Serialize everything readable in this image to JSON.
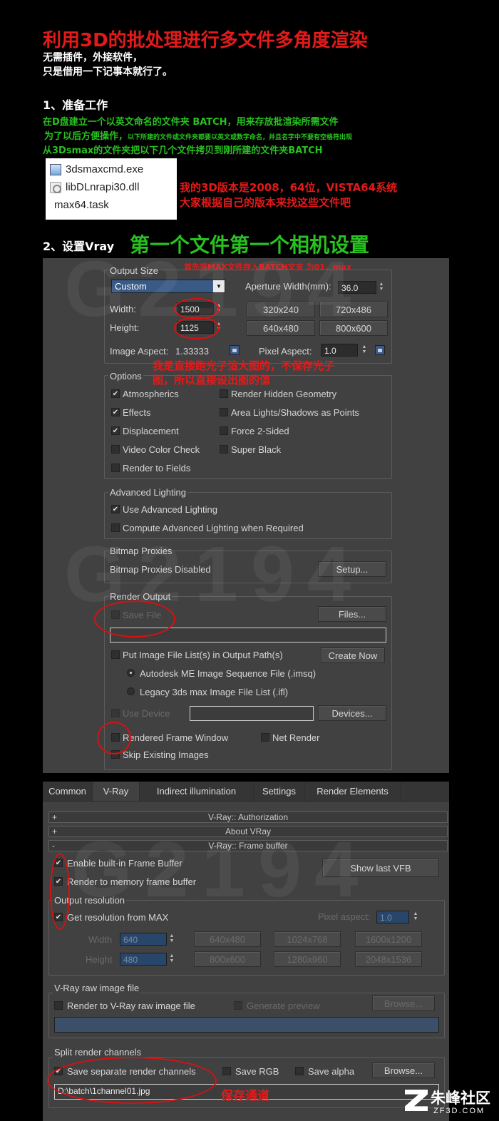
{
  "intro": {
    "title": "利用3D的批处理进行多文件多角度渲染",
    "line1": "无需插件，外接软件，",
    "line2": "只是借用一下记事本就行了。",
    "section1": "1、准备工作",
    "step_a": "在D盘建立一个以英文命名的文件夹 BATCH，用来存放批渲染所需文件",
    "step_b_big": "为了以后方便操作，",
    "step_b_small": "以下所建的文件或文件夹都要以英文或数字命名，并且名字中不要有空格符出现",
    "step_c": "从3Dsmax的文件夹把以下几个文件拷贝到刚所建的文件夹BATCH",
    "files": [
      "3dsmaxcmd.exe",
      "libDLnrapi30.dll",
      "max64.task"
    ],
    "version_note1": "我的3D版本是2008，64位，VISTA64系统",
    "version_note2": "大家根据自己的版本来找这些文件吧",
    "section2": "2、设置Vray",
    "banner": "第一个文件第一个相机设置",
    "save_note": "首先将MAX文件存入BATCH文夹 为01．max",
    "photon_note1": "我是直接跑光子渲大图的，不保存光子",
    "photon_note2": "图，所以直接设出图的值",
    "channel_note": "保存通道"
  },
  "common": {
    "output_size": "Output Size",
    "preset": "Custom",
    "aperture_label": "Aperture Width(mm):",
    "aperture_value": "36.0",
    "width_label": "Width:",
    "width_value": "1500",
    "height_label": "Height:",
    "height_value": "1125",
    "presets": [
      "320x240",
      "720x486",
      "640x480",
      "800x600"
    ],
    "image_aspect_label": "Image Aspect:",
    "image_aspect_value": "1.33333",
    "pixel_aspect_label": "Pixel Aspect:",
    "pixel_aspect_value": "1.0",
    "options": "Options",
    "opt_atmospherics": "Atmospherics",
    "opt_render_hidden": "Render Hidden Geometry",
    "opt_effects": "Effects",
    "opt_area_lights": "Area Lights/Shadows as Points",
    "opt_displacement": "Displacement",
    "opt_force_2sided": "Force 2-Sided",
    "opt_video_color": "Video Color Check",
    "opt_super_black": "Super Black",
    "opt_render_fields": "Render to Fields",
    "adv_lighting": "Advanced Lighting",
    "use_adv_lighting": "Use Advanced Lighting",
    "compute_adv_lighting": "Compute Advanced Lighting when Required",
    "bitmap_proxies": "Bitmap Proxies",
    "bitmap_proxies_disabled": "Bitmap Proxies Disabled",
    "setup": "Setup...",
    "render_output": "Render Output",
    "save_file": "Save File",
    "files_btn": "Files...",
    "put_image_list": "Put Image File List(s) in Output Path(s)",
    "create_now": "Create Now",
    "autodesk_me": "Autodesk ME Image Sequence File (.imsq)",
    "legacy_ifl": "Legacy 3ds max Image File List (.ifl)",
    "use_device": "Use Device",
    "devices_btn": "Devices...",
    "rendered_frame_window": "Rendered Frame Window",
    "net_render": "Net Render",
    "skip_existing": "Skip Existing Images"
  },
  "vray": {
    "tabs": [
      "Common",
      "V-Ray",
      "Indirect illumination",
      "Settings",
      "Render Elements"
    ],
    "rollout_auth": "V-Ray:: Authorization",
    "rollout_about": "About VRay",
    "rollout_fb": "V-Ray:: Frame buffer",
    "plus": "+",
    "minus": "-",
    "enable_fb": "Enable built-in Frame Buffer",
    "render_memory": "Render to memory frame buffer",
    "show_last_vfb": "Show last VFB",
    "output_resolution": "Output resolution",
    "get_res_max": "Get resolution from MAX",
    "pixel_aspect_label": "Pixel aspect:",
    "pixel_aspect_value": "1.0",
    "width_label": "Width",
    "width_value": "640",
    "height_label": "Height",
    "height_value": "480",
    "res_buttons": [
      "640x480",
      "1024x768",
      "1600x1200",
      "800x600",
      "1280x960",
      "2048x1536"
    ],
    "raw_image": "V-Ray raw image file",
    "render_raw": "Render to V-Ray raw image file",
    "generate_preview": "Generate preview",
    "browse": "Browse...",
    "split_channels": "Split render channels",
    "save_separate": "Save separate render channels",
    "save_rgb": "Save RGB",
    "save_alpha": "Save alpha",
    "channel_path": "D:\\batch\\1channel01.jpg"
  },
  "watermark": {
    "text": "G2194",
    "site_cn": "朱峰社区",
    "site_url": "ZF3D.COM"
  }
}
